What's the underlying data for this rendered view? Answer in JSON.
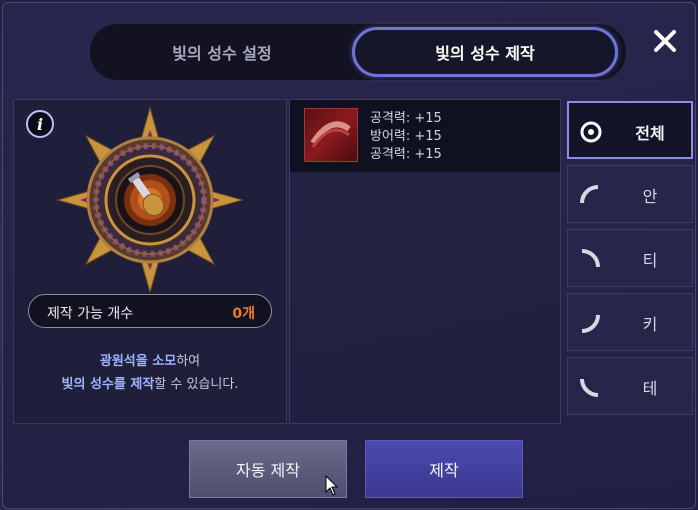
{
  "tabs": [
    {
      "label": "빛의 성수 설정",
      "active": false
    },
    {
      "label": "빛의 성수 제작",
      "active": true
    }
  ],
  "close_icon": "close-icon",
  "info_icon": "info-icon",
  "craftable": {
    "label": "제작 가능 개수",
    "value": "0개",
    "value_color": "#f07a2a"
  },
  "description": {
    "line1_highlight": "광원석을 소모",
    "line1_rest": "하여",
    "line2_highlight": "빛의 성수를 제작",
    "line2_rest": "할 수 있습니다."
  },
  "item": {
    "stats": [
      "공격력: +15",
      "방어력: +15",
      "공격력: +15"
    ]
  },
  "filters": [
    {
      "label": "전체",
      "icon": "full-circle-icon",
      "active": true
    },
    {
      "label": "안",
      "icon": "arc-top-left-icon",
      "active": false
    },
    {
      "label": "티",
      "icon": "arc-top-right-icon",
      "active": false
    },
    {
      "label": "키",
      "icon": "arc-bottom-right-icon",
      "active": false
    },
    {
      "label": "테",
      "icon": "arc-bottom-left-icon",
      "active": false
    }
  ],
  "buttons": {
    "auto_craft": "자동 제작",
    "craft": "제작"
  },
  "colors": {
    "accent": "#6f73d8",
    "highlight_text": "#9fb4ff"
  }
}
